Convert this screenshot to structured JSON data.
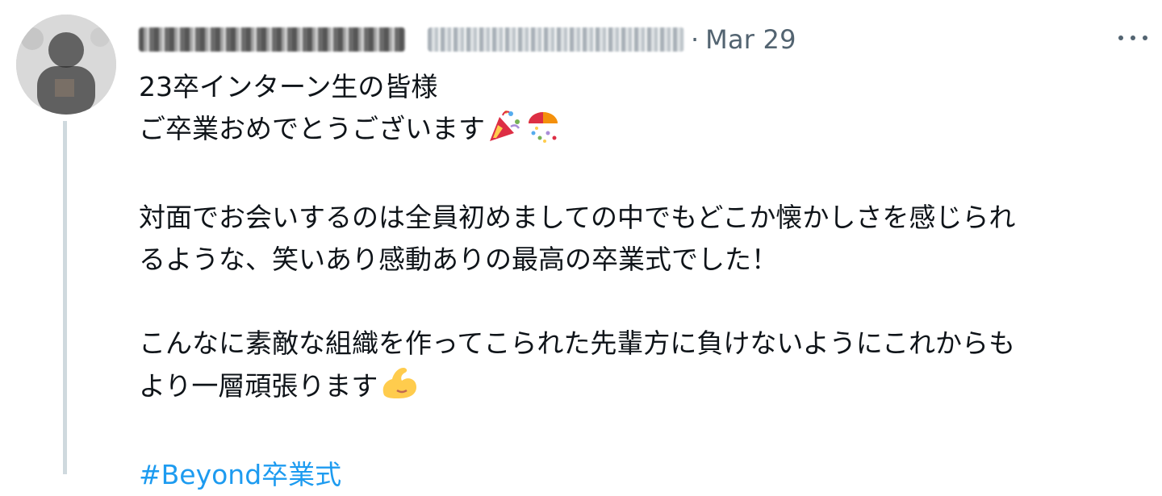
{
  "tweet": {
    "date": "Mar 29",
    "lines": [
      "23卒インターン生の皆様",
      "ご卒業おめでとうございます",
      "",
      "対面でお会いするのは全員初めましての中でもどこか懐かしさを感じられ",
      "るような、笑いあり感動ありの最高の卒業式でした！",
      "",
      "こんなに素敵な組織を作ってこられた先輩方に負けないようにこれからも",
      "より一層頑張ります",
      ""
    ],
    "hashtag": "#Beyond卒業式",
    "icons": {
      "avatar": "avatar-blurred",
      "more": "more-horizontal-icon",
      "party_popper": "party-popper-emoji",
      "confetti_ball": "confetti-ball-emoji",
      "flexed_biceps": "flexed-biceps-emoji"
    },
    "colors": {
      "text": "#0f1419",
      "secondary": "#536471",
      "link": "#1d9bf0",
      "thread_line": "#cfd9de"
    }
  }
}
